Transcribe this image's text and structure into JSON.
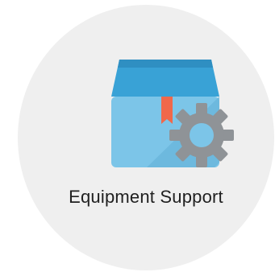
{
  "tile": {
    "icon": "box-with-gear-icon",
    "label": "Equipment Support",
    "colors": {
      "card_background": "#efefef",
      "box_light": "#7cc5e8",
      "box_dark": "#39a2d6",
      "ribbon": "#f0684a",
      "gear": "#8f9397",
      "gear_hub": "#7cc5e8"
    }
  }
}
